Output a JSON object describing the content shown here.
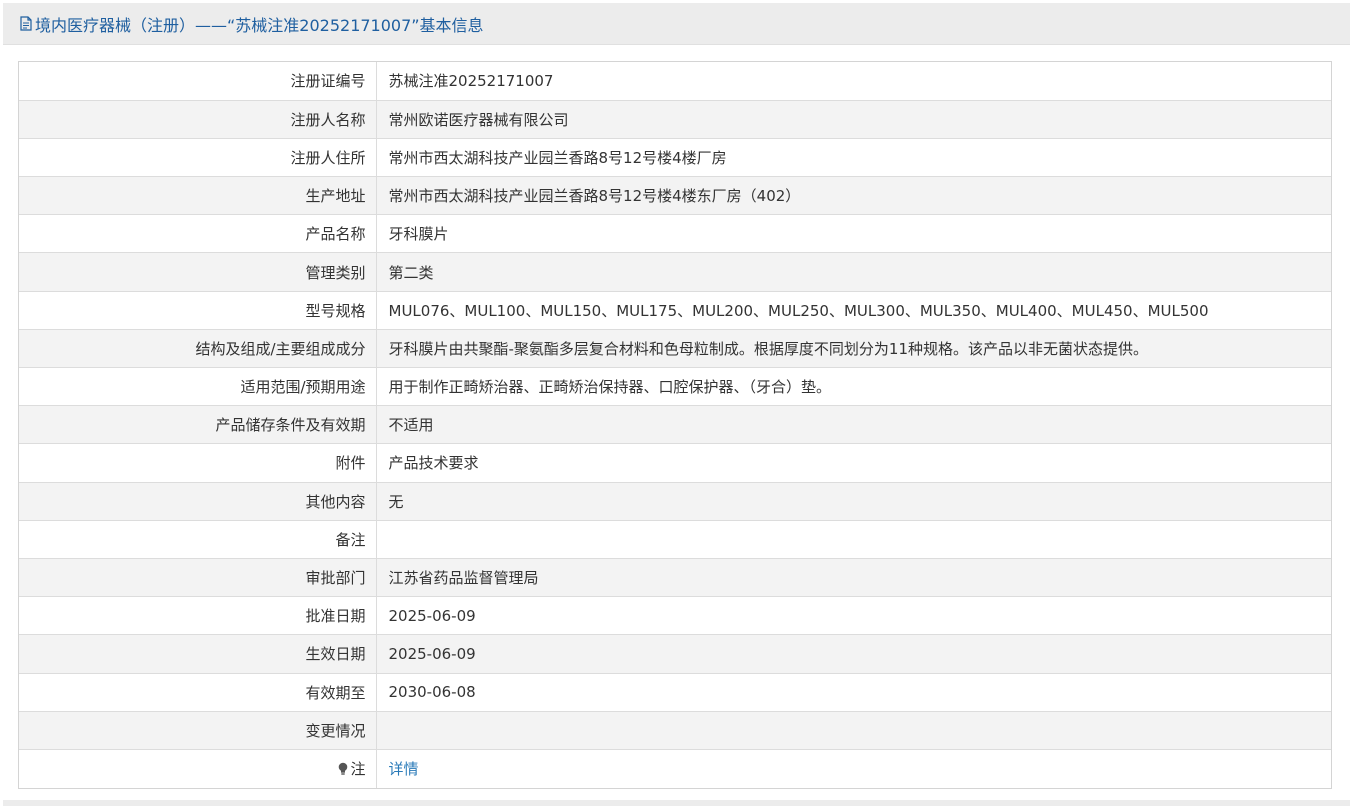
{
  "header": {
    "title": "境内医疗器械（注册）——“苏械注准20252171007”基本信息"
  },
  "rows": [
    {
      "label": "注册证编号",
      "value": "苏械注准20252171007"
    },
    {
      "label": "注册人名称",
      "value": "常州欧诺医疗器械有限公司"
    },
    {
      "label": "注册人住所",
      "value": "常州市西太湖科技产业园兰香路8号12号楼4楼厂房"
    },
    {
      "label": "生产地址",
      "value": "常州市西太湖科技产业园兰香路8号12号楼4楼东厂房（402）"
    },
    {
      "label": "产品名称",
      "value": "牙科膜片"
    },
    {
      "label": "管理类别",
      "value": "第二类"
    },
    {
      "label": "型号规格",
      "value": "MUL076、MUL100、MUL150、MUL175、MUL200、MUL250、MUL300、MUL350、MUL400、MUL450、MUL500"
    },
    {
      "label": "结构及组成/主要组成成分",
      "value": "牙科膜片由共聚酯-聚氨酯多层复合材料和色母粒制成。根据厚度不同划分为11种规格。该产品以非无菌状态提供。"
    },
    {
      "label": "适用范围/预期用途",
      "value": "用于制作正畸矫治器、正畸矫治保持器、口腔保护器、（牙合）垫。"
    },
    {
      "label": "产品储存条件及有效期",
      "value": "不适用"
    },
    {
      "label": "附件",
      "value": "产品技术要求"
    },
    {
      "label": "其他内容",
      "value": "无"
    },
    {
      "label": "备注",
      "value": ""
    },
    {
      "label": "审批部门",
      "value": "江苏省药品监督管理局"
    },
    {
      "label": "批准日期",
      "value": "2025-06-09"
    },
    {
      "label": "生效日期",
      "value": "2025-06-09"
    },
    {
      "label": "有效期至",
      "value": "2030-06-08"
    },
    {
      "label": "变更情况",
      "value": ""
    }
  ],
  "note_row": {
    "label": "注",
    "link_text": "详情",
    "icon": "lightbulb-icon"
  },
  "colors": {
    "header_text": "#1f5fa0",
    "link": "#2a7ab8",
    "alt_row": "#f3f3f3"
  }
}
